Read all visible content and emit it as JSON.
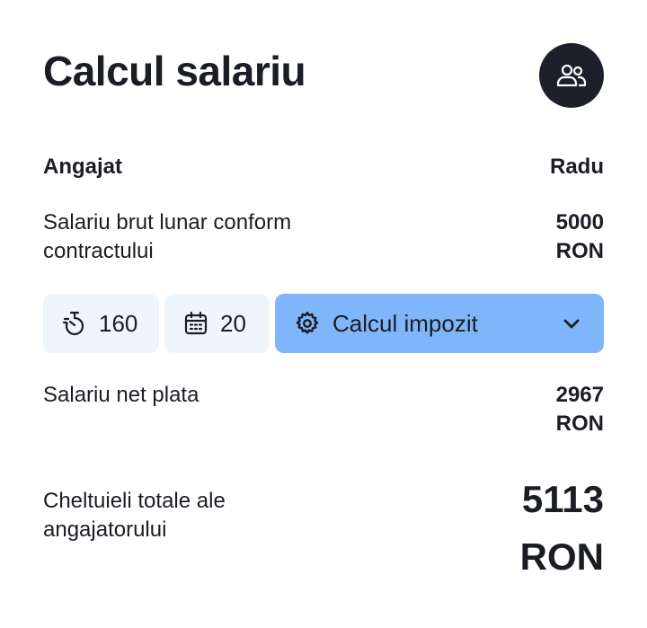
{
  "header": {
    "title": "Calcul salariu",
    "people_icon": "users-icon"
  },
  "employee": {
    "label": "Angajat",
    "value": "Radu"
  },
  "gross_salary": {
    "label": "Salariu brut lunar conform contractului",
    "amount": "5000",
    "currency": "RON"
  },
  "controls": {
    "hours": {
      "icon": "stopwatch-icon",
      "value": "160"
    },
    "days": {
      "icon": "calendar-icon",
      "value": "20"
    },
    "tax_select": {
      "icon": "gear-icon",
      "label": "Calcul impozit",
      "chevron_icon": "chevron-down-icon"
    }
  },
  "net_salary": {
    "label": "Salariu net plata",
    "amount": "2967",
    "currency": "RON"
  },
  "employer_total": {
    "label": "Cheltuieli totale ale angajatorului",
    "amount": "5113",
    "currency": "RON"
  },
  "colors": {
    "dark": "#1d1f2a",
    "pill_bg": "#eff5fd",
    "accent": "#7fb6f9"
  }
}
